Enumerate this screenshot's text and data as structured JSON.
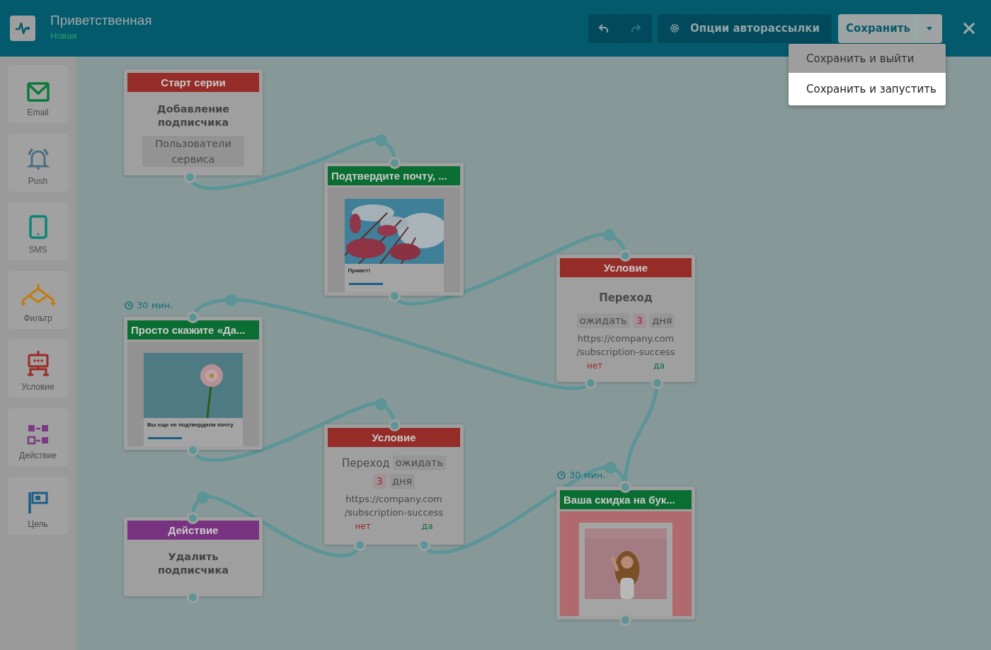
{
  "header": {
    "title": "Приветственная",
    "status": "Новая"
  },
  "toolbar": {
    "undo": {
      "disabled": false
    },
    "redo": {
      "disabled": true
    },
    "options_button": "Опции авторассылки",
    "save_button": "Сохранить"
  },
  "save_menu": [
    {
      "label": "Сохранить и выйти",
      "selected": false
    },
    {
      "label": "Сохранить и запустить",
      "selected": true
    }
  ],
  "palette": [
    {
      "kind": "email",
      "label": "Email"
    },
    {
      "kind": "push",
      "label": "Push"
    },
    {
      "kind": "sms",
      "label": "SMS"
    },
    {
      "kind": "filter",
      "label": "Фильтр"
    },
    {
      "kind": "condition",
      "label": "Условие"
    },
    {
      "kind": "action",
      "label": "Действие"
    },
    {
      "kind": "goal",
      "label": "Цель"
    }
  ],
  "nodes": [
    {
      "kind": "start",
      "title": "Старт серии",
      "text": "Добавление подписчика",
      "tag": "Пользователи сервиса"
    },
    {
      "kind": "email",
      "title": "Подтвердите почту, ...",
      "preview": {
        "kind": "blossom",
        "heading": "Привет!"
      }
    },
    {
      "kind": "condition",
      "title": "Условие",
      "event": "Переход",
      "event_bold": true,
      "wait": "ожидать",
      "count": "3",
      "unit": "дня",
      "url_lines": [
        "https://company.com",
        "/subscription-success"
      ],
      "no": "нет",
      "yes": "да"
    },
    {
      "kind": "email",
      "title": "Просто скажите «Да...",
      "delay": "30 мин.",
      "preview": {
        "kind": "flower",
        "heading": "Вы еще не подтвердили почту"
      }
    },
    {
      "kind": "condition",
      "title": "Условие",
      "event": "Переход",
      "event_bold": false,
      "wait": "ожидать",
      "count": "3",
      "unit": "дня",
      "url_lines": [
        "https://company.com",
        "/subscription-success"
      ],
      "no": "нет",
      "yes": "да"
    },
    {
      "kind": "action",
      "title": "Действие",
      "text": "Удалить подписчика"
    },
    {
      "kind": "email",
      "title": "Ваша скидка на бук...",
      "delay": "30 мин.",
      "preview": {
        "kind": "sale"
      }
    }
  ]
}
